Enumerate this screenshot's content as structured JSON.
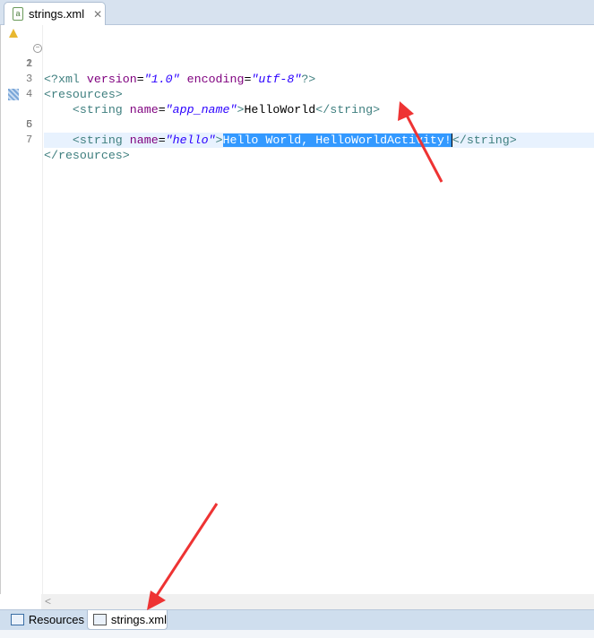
{
  "editor_tab": {
    "title": "strings.xml",
    "close": "✕"
  },
  "lines": [
    {
      "n": "1"
    },
    {
      "n": "2"
    },
    {
      "n": "3"
    },
    {
      "n": "4"
    },
    {
      "n": "5"
    },
    {
      "n": "6"
    },
    {
      "n": "7"
    }
  ],
  "code": {
    "l1": {
      "p1": "<?xml ",
      "a1": "version",
      "eq1": "=",
      "v1": "\"1.0\"",
      "sp": " ",
      "a2": "encoding",
      "eq2": "=",
      "v2": "\"utf-8\"",
      "end": "?>"
    },
    "l2": "<resources>",
    "l4": {
      "open": "    <string ",
      "attr": "name",
      "eq": "=",
      "val": "\"app_name\"",
      "gt": ">",
      "text": "HelloWorld",
      "close": "</string>"
    },
    "l5": {
      "open": "    <string ",
      "attr": "name",
      "eq": "=",
      "val": "\"hello\"",
      "gt": ">",
      "text": "Hello World, HelloWorldActivity!",
      "close": "</string>"
    },
    "l7": "</resources>"
  },
  "scroll_left": "<",
  "bottom_tabs": [
    {
      "label": "Resources"
    },
    {
      "label": "strings.xml",
      "active": true
    }
  ],
  "colors": {
    "selection": "#3399ff",
    "annotation": "#ee3333"
  }
}
